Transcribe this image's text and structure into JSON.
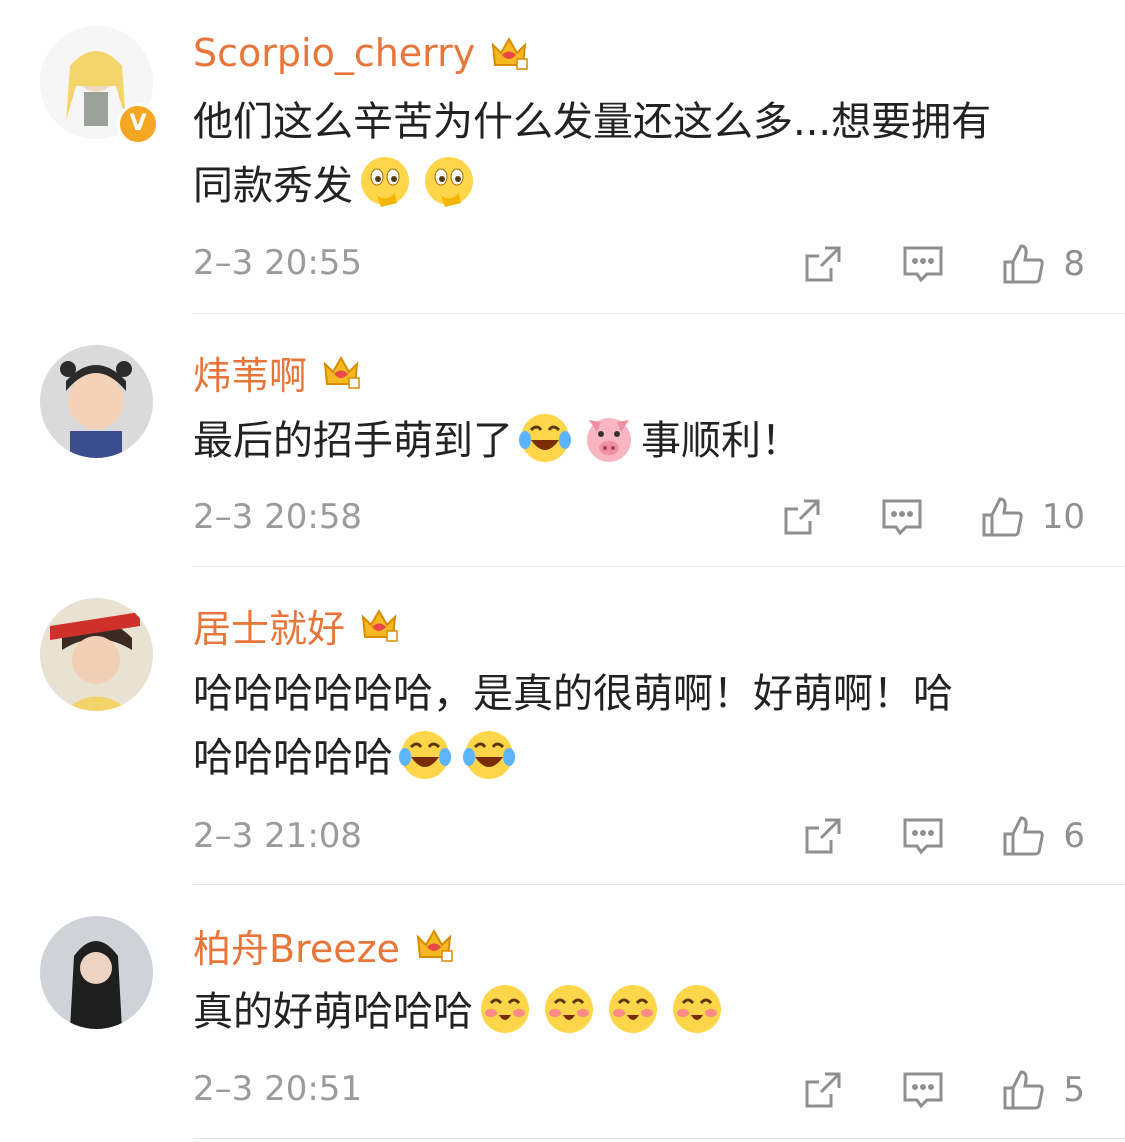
{
  "comments": [
    {
      "username": "Scorpio_cherry",
      "verified_badge": "V",
      "text_line1": "他们这么辛苦为什么发量还这么多...想要拥有",
      "text_line2": "同款秀发",
      "emojis": [
        "thinking-emoji",
        "thinking-emoji"
      ],
      "time": "2–3 20:55",
      "likes": "8"
    },
    {
      "username": "炜苇啊",
      "text_before": "最后的招手萌到了",
      "text_after": "事顺利！",
      "emojis": [
        "laughing-tears-emoji",
        "pig-emoji"
      ],
      "time": "2–3 20:58",
      "likes": "10"
    },
    {
      "username": "居士就好",
      "text_line1": "哈哈哈哈哈哈，是真的很萌啊！好萌啊！哈",
      "text_line2": "哈哈哈哈哈",
      "emojis": [
        "laughing-tears-emoji",
        "laughing-tears-emoji"
      ],
      "time": "2–3 21:08",
      "likes": "6"
    },
    {
      "username": "柏舟Breeze",
      "text": "真的好萌哈哈哈",
      "emojis": [
        "blush-emoji",
        "blush-emoji",
        "blush-emoji",
        "blush-emoji"
      ],
      "time": "2–3 20:51",
      "likes": "5"
    }
  ],
  "colors": {
    "username": "#e8763a",
    "meta": "#9b9b9b",
    "text": "#222222",
    "badge": "#f5a623"
  },
  "icons": {
    "repost": "share-icon",
    "comment": "comment-icon",
    "like": "thumbs-up-icon",
    "vip": "crown-icon"
  }
}
